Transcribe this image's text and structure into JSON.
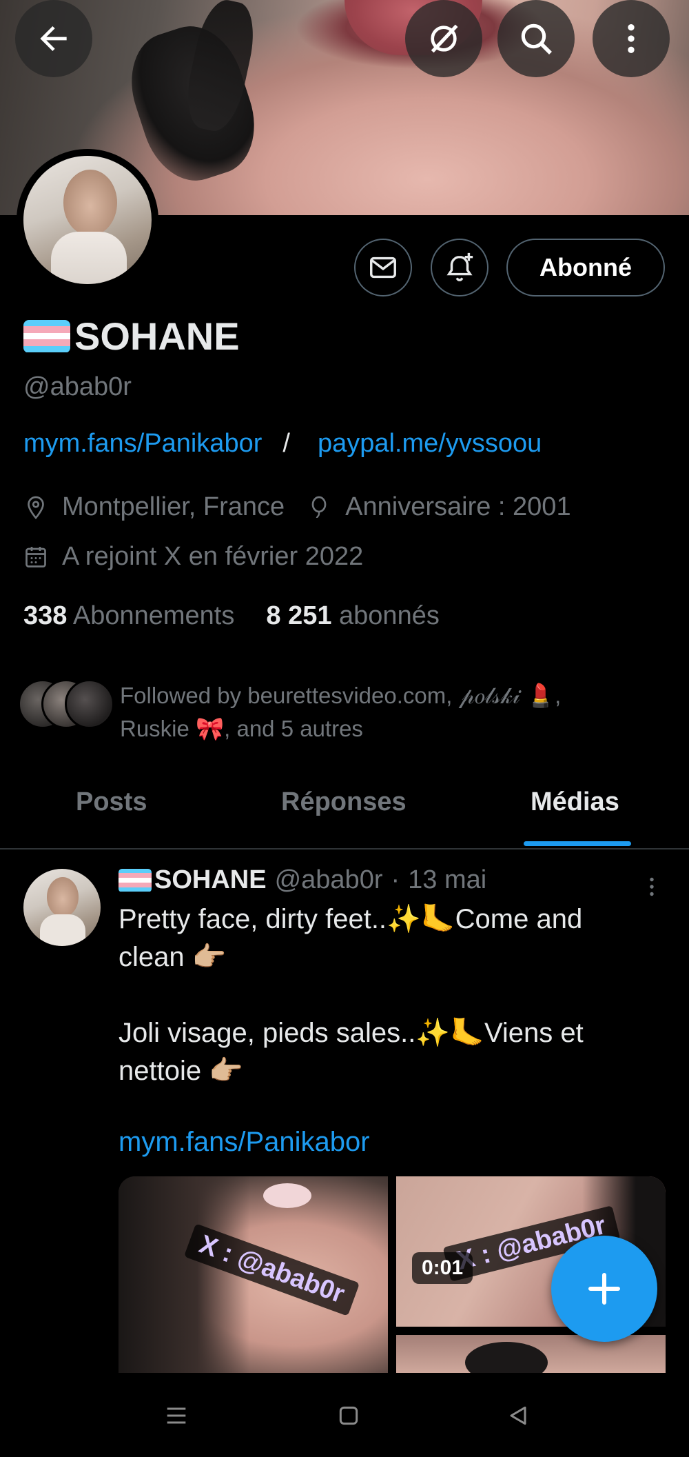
{
  "header": {
    "back_icon": "arrow-left-icon",
    "grok_icon": "grok-icon",
    "search_icon": "search-icon",
    "more_icon": "more-vertical-icon"
  },
  "profile": {
    "display_name": "SOHANE",
    "handle": "@abab0r",
    "links": [
      "mym.fans/Panikabor",
      "paypal.me/yvssoou"
    ],
    "link_separator": "/",
    "location": "Montpellier, France",
    "birthday": "Anniversaire : 2001",
    "joined": "A rejoint X en février 2022",
    "following_count": "338",
    "following_label": "Abonnements",
    "followers_count": "8 251",
    "followers_label": "abonnés",
    "followed_by": "Followed by beurettesvideo.com, 𝓅𝑜𝓁𝓈𝓀𝒾 💄,",
    "followed_by_2": "Ruskie 🎀, and 5 autres",
    "follow_button": "Abonné"
  },
  "tabs": [
    {
      "label": "Posts",
      "active": false
    },
    {
      "label": "Réponses",
      "active": false
    },
    {
      "label": "Médias",
      "active": true
    }
  ],
  "post": {
    "name": "SOHANE",
    "handle": "@abab0r",
    "dot": "·",
    "date": "13 mai",
    "line1": "Pretty face, dirty feet..✨🦶Come and",
    "line2": "clean 👉🏼",
    "line3": "Joli visage, pieds sales..✨🦶Viens et",
    "line4": "nettoie 👉🏼",
    "link": "mym.fans/Panikabor",
    "watermark1": "X : @abab0r",
    "watermark2": "X : @abab0r",
    "video_duration": "0:01"
  },
  "colors": {
    "accent": "#1d9bf0",
    "background": "#000000",
    "secondary_text": "#71767b",
    "flag_blue": "#5bcefa",
    "flag_pink": "#f5a9b8",
    "flag_white": "#ffffff"
  }
}
